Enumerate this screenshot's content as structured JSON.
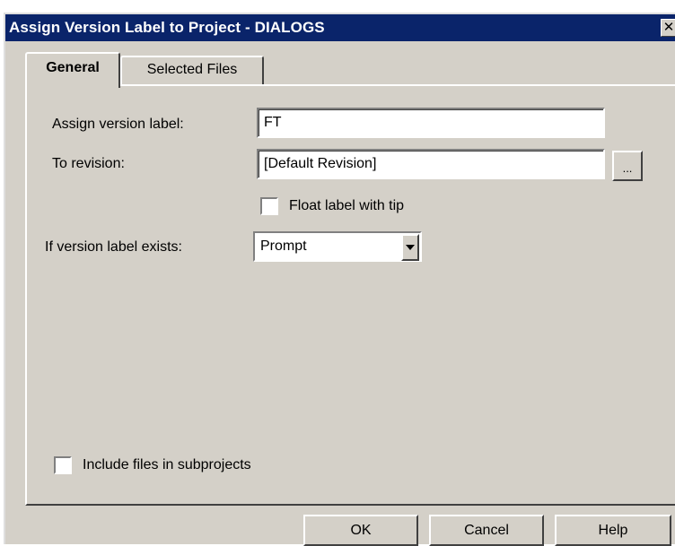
{
  "window": {
    "title": "Assign Version Label to Project - DIALOGS",
    "close_glyph": "✕"
  },
  "tabs": [
    {
      "label": "General",
      "active": true
    },
    {
      "label": "Selected Files",
      "active": false
    }
  ],
  "form": {
    "assign_label": "Assign version label:",
    "assign_value": "FT",
    "revision_label": "To revision:",
    "revision_value": "[Default Revision]",
    "browse_label": "...",
    "float_label": "Float label with tip",
    "float_checked": false,
    "exists_label": "If version label exists:",
    "exists_value": "Prompt",
    "include_label": "Include files in subprojects",
    "include_checked": false
  },
  "buttons": {
    "ok": "OK",
    "cancel": "Cancel",
    "help": "Help"
  },
  "colors": {
    "titlebar": "#0a246a",
    "face": "#d4d0c8"
  }
}
